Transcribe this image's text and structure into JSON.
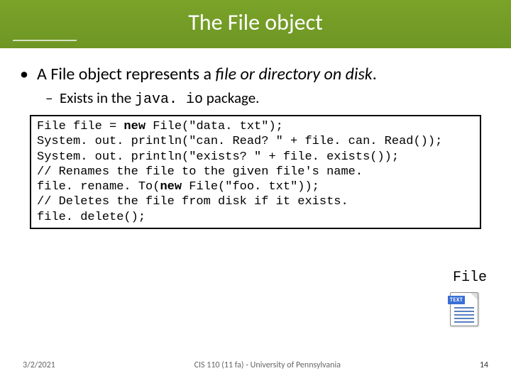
{
  "title": "The File object",
  "bullet1": {
    "prefix": "A File object represents a ",
    "italic": "file or directory on disk",
    "suffix": "."
  },
  "bullet2": {
    "prefix": "Exists in the ",
    "mono": "java. io",
    "suffix": " package."
  },
  "code": {
    "l1a": "File file = ",
    "l1kw": "new",
    "l1b": " File(\"data. txt\");",
    "l2": "System. out. println(\"can. Read? \" + file. can. Read());",
    "l3": "System. out. println(\"exists? \" + file. exists());",
    "l4": "// Renames the file to the given file's name.",
    "l5a": "file. rename. To(",
    "l5kw": "new",
    "l5b": " File(\"foo. txt\"));",
    "l6": "// Deletes the file from disk if it exists.",
    "l7": "file. delete();"
  },
  "file_label": "File",
  "icon_banner": "TEXT",
  "footer": {
    "date": "3/2/2021",
    "center": "CIS 110 (11 fa) - University of Pennsylvania",
    "page": "14"
  }
}
